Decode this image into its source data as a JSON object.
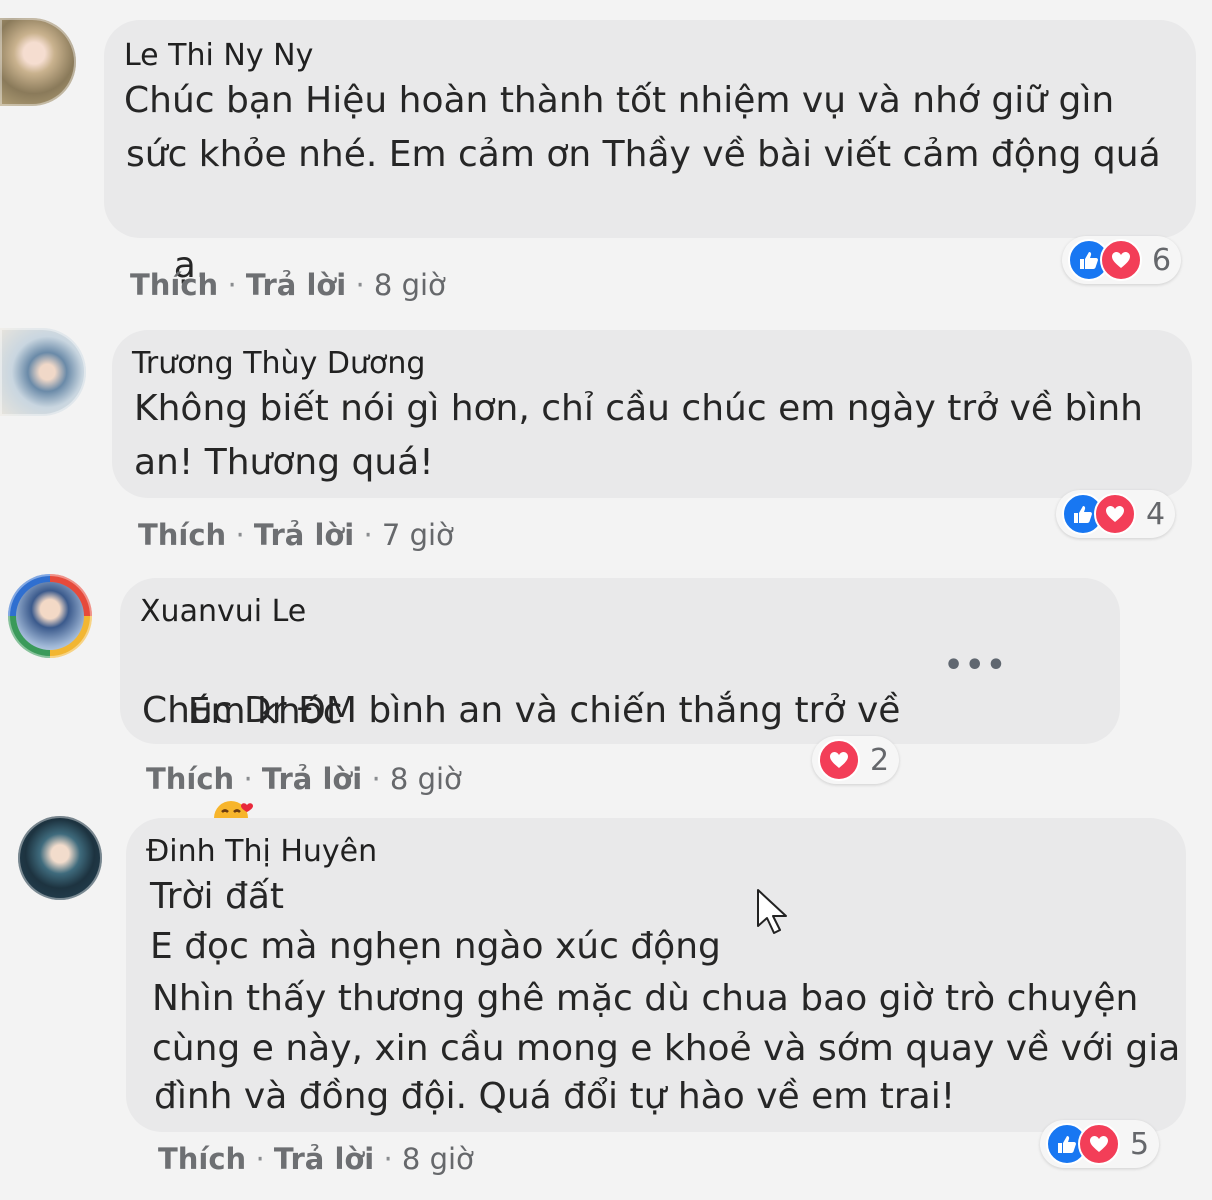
{
  "comments": [
    {
      "author": "Le Thi Ny Ny",
      "lines": [
        "Chúc bạn Hiệu hoàn thành tốt nhiệm vụ và nhớ giữ gìn",
        "sức khỏe nhé. Em cảm ơn Thầy về bài viết cảm động quá",
        "ạ."
      ],
      "emoji": "heart",
      "like_label": "Thích",
      "reply_label": "Trả lời",
      "time": "8 giờ",
      "reaction_count": "6",
      "reactions": [
        "like",
        "love"
      ]
    },
    {
      "author": "Trương Thùy Dương",
      "lines": [
        "Không biết nói gì hơn, chỉ cầu chúc em ngày trở về bình",
        "an! Thương quá!"
      ],
      "like_label": "Thích",
      "reply_label": "Trả lời",
      "time": "7 giờ",
      "reaction_count": "4",
      "reactions": [
        "like",
        "love"
      ]
    },
    {
      "author": "Xuanvui Le",
      "lines": [
        "Em khóc",
        "Chúc Dr ĐM bình an và chiến thắng trở về"
      ],
      "emoji": "smiling-face-with-hearts",
      "like_label": "Thích",
      "reply_label": "Trả lời",
      "time": "8 giờ",
      "reaction_count": "2",
      "reactions": [
        "love"
      ]
    },
    {
      "author": "Đinh Thị Huyên",
      "lines": [
        "Trời đất",
        "E đọc mà nghẹn ngào xúc động",
        "Nhìn thấy thương ghê mặc dù chua bao giờ trò chuyện",
        "cùng e này, xin cầu mong e khoẻ và sớm quay về với gia",
        "đình và đồng đội. Quá đổi tự hào về em trai!"
      ],
      "like_label": "Thích",
      "reply_label": "Trả lời",
      "time": "8 giờ",
      "reaction_count": "5",
      "reactions": [
        "like",
        "love"
      ]
    }
  ],
  "separator": "·",
  "more_options": "•••",
  "colors": {
    "like": "#1877f2",
    "love": "#f33e58",
    "bubble": "#e9e9ea",
    "background": "#f3f3f3"
  }
}
